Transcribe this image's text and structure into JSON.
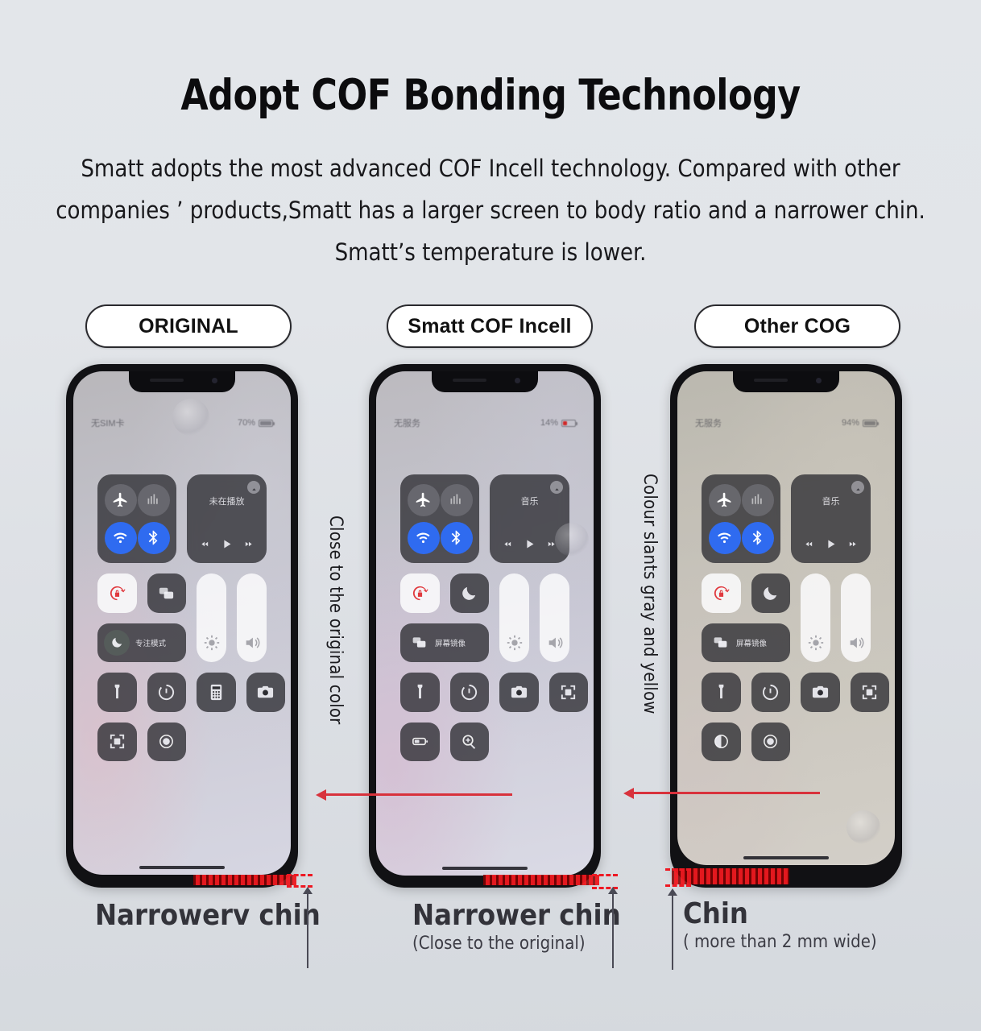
{
  "header": {
    "title": "Adopt COF Bonding Technology",
    "subtitle_lines": [
      "Smatt adopts the most advanced COF Incell technology. Compared with other",
      "companies ’ products,Smatt has a larger screen to body ratio and a narrower chin.",
      "Smatt’s temperature is lower."
    ]
  },
  "colors": {
    "background": "#e1e4e9",
    "accent_red": "#ee1822",
    "arrow_red": "#d8323c",
    "toggle_blue": "#2f6bf0",
    "caption_gray": "#33333a"
  },
  "pills": [
    {
      "label": "ORIGINAL"
    },
    {
      "label": "Smatt COF Incell"
    },
    {
      "label": "Other COG"
    }
  ],
  "phones": [
    {
      "id": "original",
      "status": {
        "carrier": "无SIM卡",
        "battery": "70%"
      },
      "media": {
        "label": "未在播放"
      },
      "focus_tile": {
        "label": "专注模式",
        "type": "focus-mode"
      },
      "mirror_tile": {
        "label": "",
        "type": "screen-mirroring"
      },
      "bottom_icons": [
        "flashlight",
        "timer",
        "calculator",
        "camera",
        "qr-scanner",
        "screen-record"
      ],
      "chin_note": "narrow"
    },
    {
      "id": "smatt-cof-incell",
      "status": {
        "carrier": "无服务",
        "battery": "14%"
      },
      "media": {
        "label": "音乐"
      },
      "focus_tile": {
        "label": "",
        "type": "do-not-disturb"
      },
      "mirror_tile": {
        "label": "屏幕镜像",
        "type": "screen-mirroring"
      },
      "bottom_icons": [
        "flashlight",
        "timer",
        "camera",
        "qr-scanner",
        "low-power",
        "magnifier"
      ],
      "chin_note": "narrower"
    },
    {
      "id": "other-cog",
      "status": {
        "carrier": "无服务",
        "battery": "94%"
      },
      "media": {
        "label": "音乐"
      },
      "focus_tile": {
        "label": "",
        "type": "do-not-disturb"
      },
      "mirror_tile": {
        "label": "屏幕镜像",
        "type": "screen-mirroring"
      },
      "bottom_icons": [
        "flashlight",
        "timer",
        "camera",
        "qr-scanner",
        "dark-mode",
        "screen-record"
      ],
      "chin_note": "wide"
    }
  ],
  "annotations": {
    "vertical": [
      {
        "text": "Close to the original color"
      },
      {
        "text": "Colour slants gray and yellow"
      }
    ]
  },
  "captions": [
    {
      "title": "Narrowerv chin",
      "sub": ""
    },
    {
      "title": "Narrower chin",
      "sub": "(Close to the original)"
    },
    {
      "title": "Chin",
      "sub": "( more than 2 mm wide)"
    }
  ]
}
